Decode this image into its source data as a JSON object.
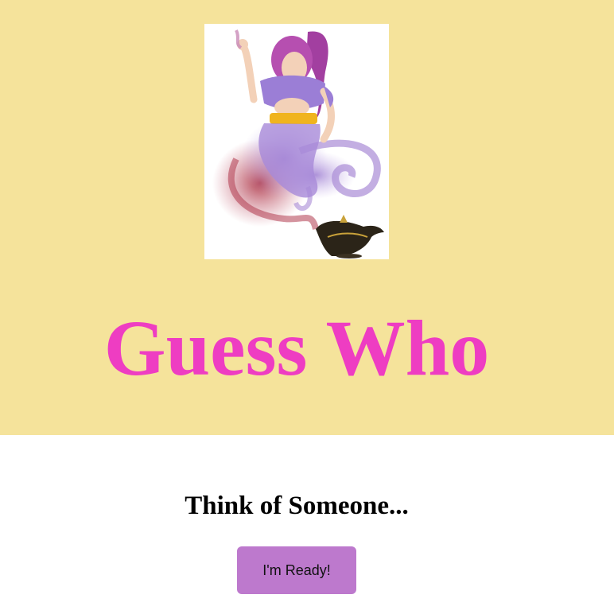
{
  "colors": {
    "hero_background": "#f5e39b",
    "title": "#ee3dc2",
    "button_background": "#bd79cd",
    "page_background": "#ffffff"
  },
  "hero": {
    "image_icon": "genie-with-lamp-illustration",
    "title": "Guess Who"
  },
  "main": {
    "prompt": "Think of Someone...",
    "ready_button_label": "I'm Ready!"
  }
}
